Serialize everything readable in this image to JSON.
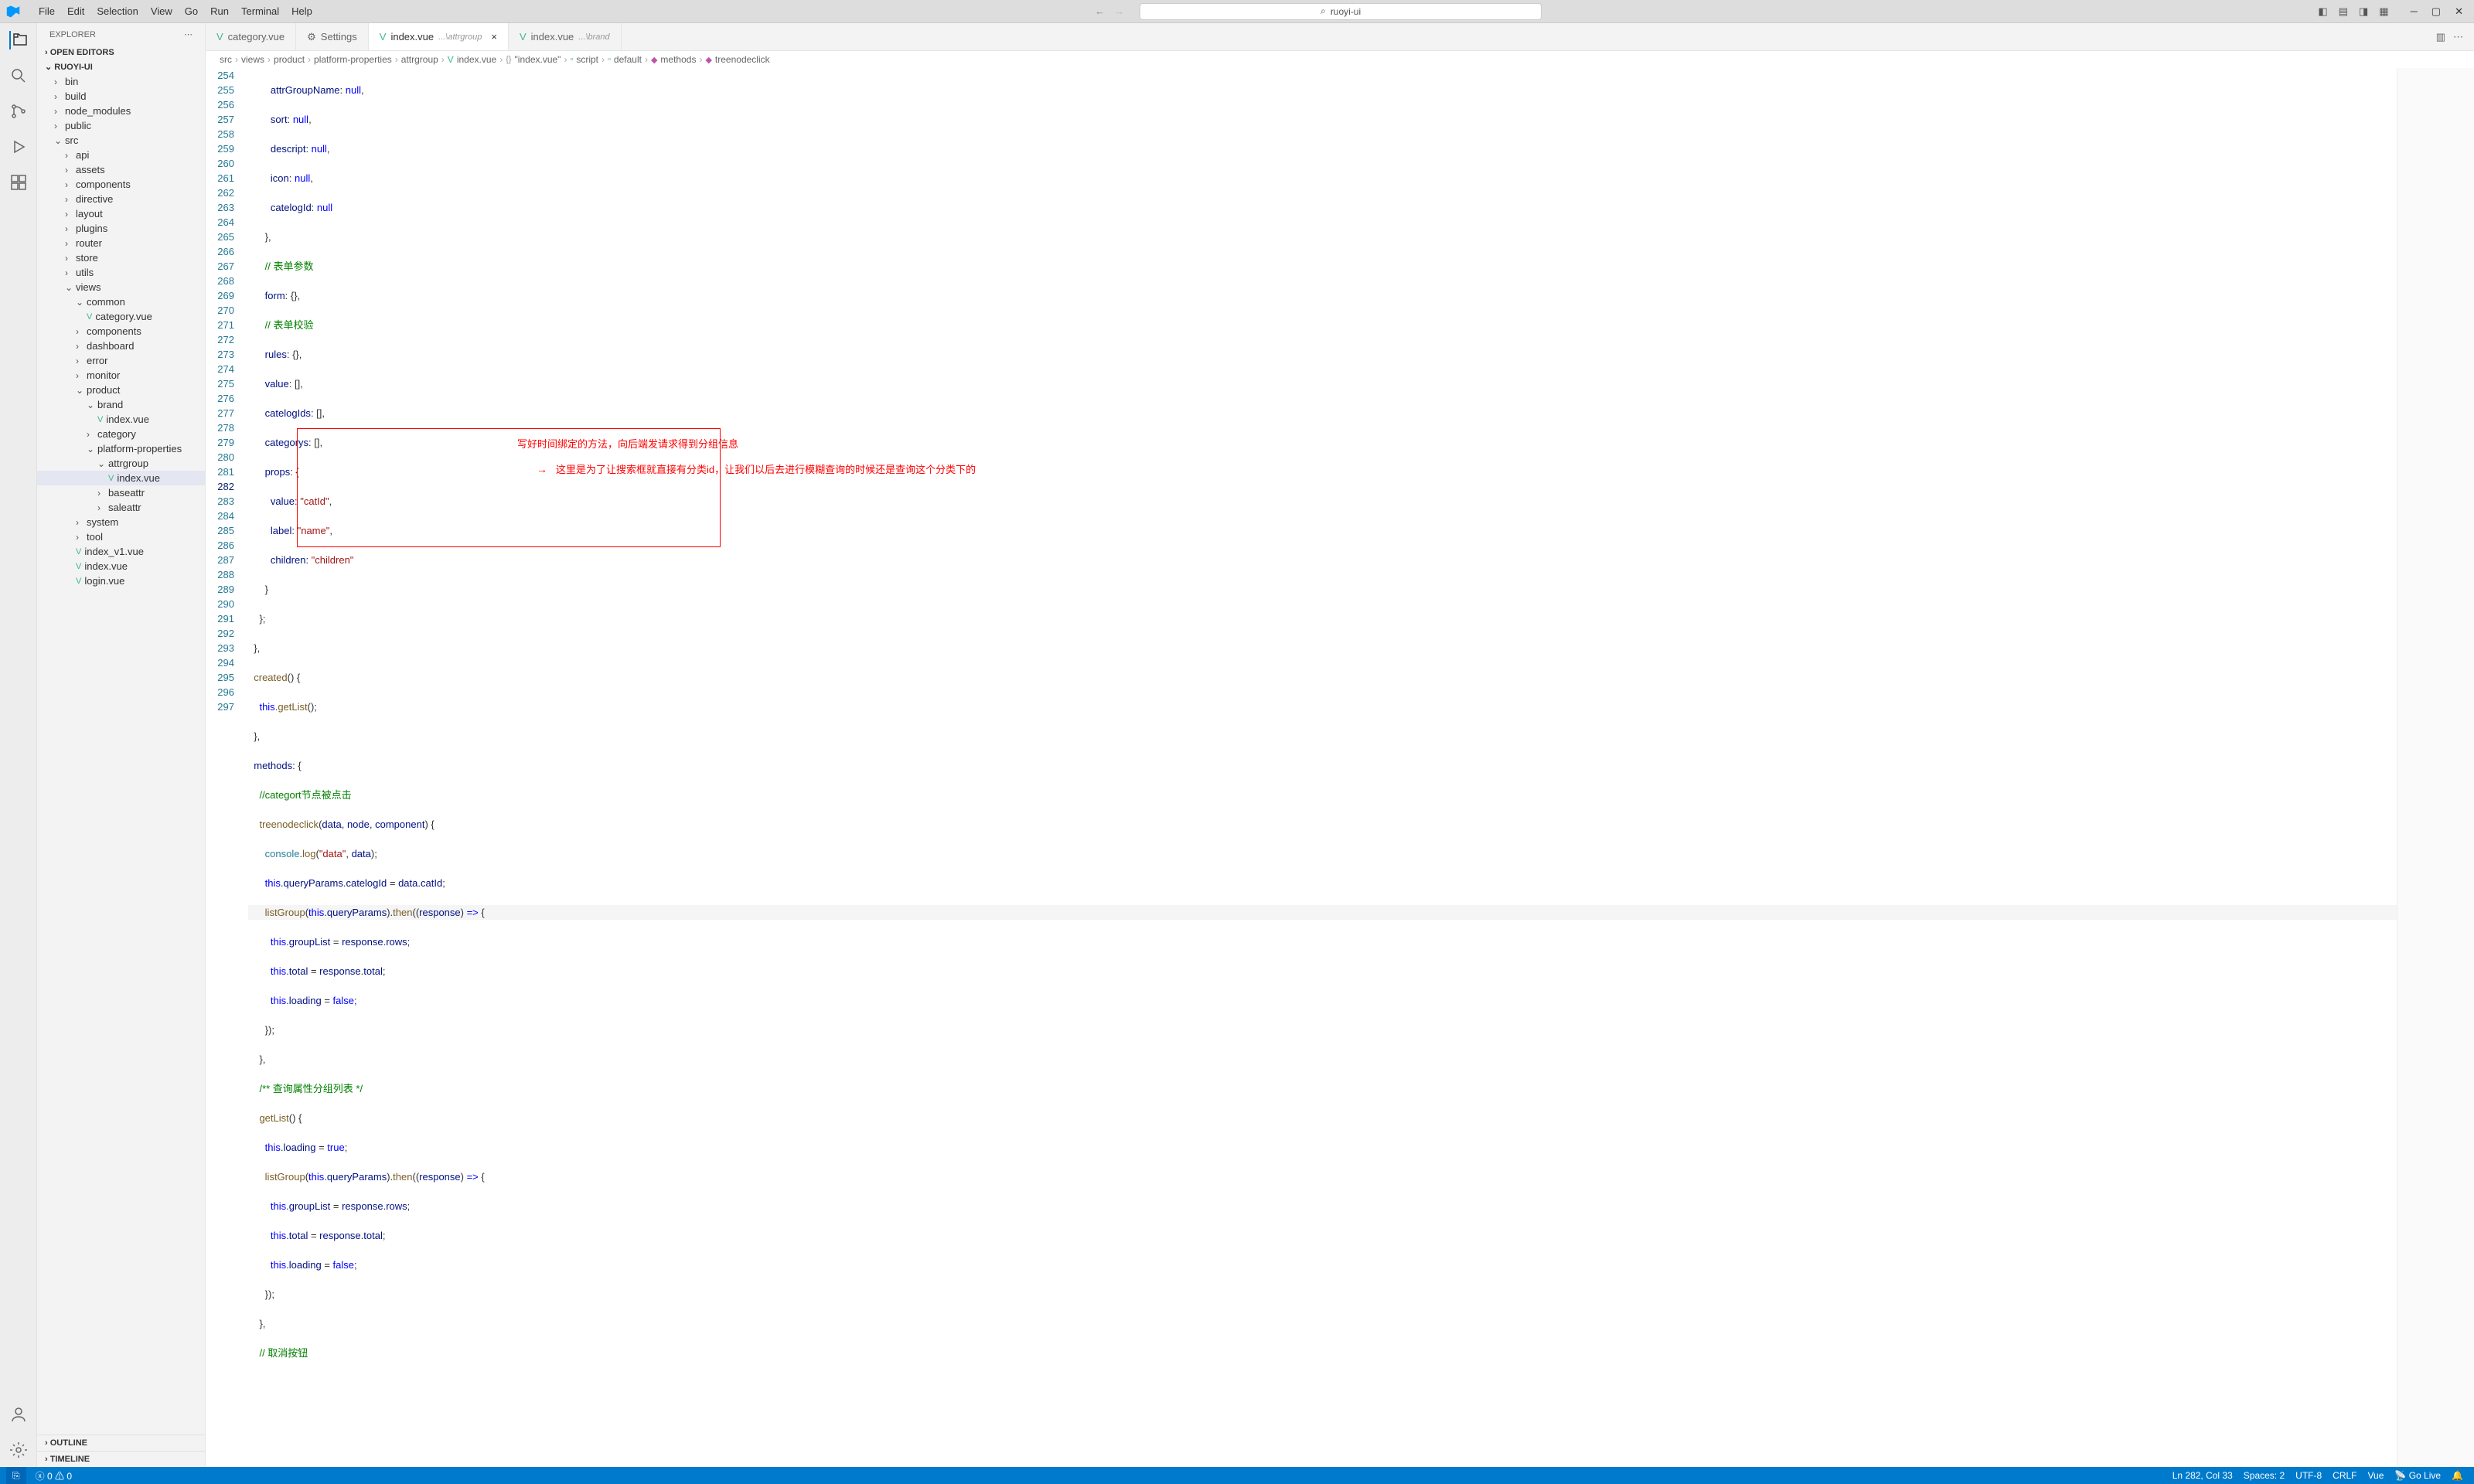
{
  "app": {
    "search_text": "ruoyi-ui"
  },
  "menu": {
    "file": "File",
    "edit": "Edit",
    "selection": "Selection",
    "view": "View",
    "go": "Go",
    "run": "Run",
    "terminal": "Terminal",
    "help": "Help"
  },
  "sidebar": {
    "title": "EXPLORER",
    "section_open": "OPEN EDITORS",
    "project": "RUOYI-UI",
    "outline": "OUTLINE",
    "timeline": "TIMELINE",
    "items": {
      "bin": "bin",
      "build": "build",
      "node_modules": "node_modules",
      "public": "public",
      "src": "src",
      "api": "api",
      "assets": "assets",
      "components": "components",
      "directive": "directive",
      "layout": "layout",
      "plugins": "plugins",
      "router": "router",
      "store": "store",
      "utils": "utils",
      "views": "views",
      "common": "common",
      "category_vue": "category.vue",
      "components2": "components",
      "dashboard": "dashboard",
      "error": "error",
      "monitor": "monitor",
      "product": "product",
      "brand": "brand",
      "index_vue": "index.vue",
      "category": "category",
      "platform_properties": "platform-properties",
      "attrgroup": "attrgroup",
      "index_vue2": "index.vue",
      "baseattr": "baseattr",
      "saleattr": "saleattr",
      "system": "system",
      "tool": "tool",
      "index_v1": "index_v1.vue",
      "index_vue3": "index.vue",
      "login_vue": "login.vue"
    }
  },
  "tabs": {
    "t1": {
      "label": "category.vue"
    },
    "t2": {
      "label": "Settings"
    },
    "t3": {
      "label": "index.vue",
      "desc": "...\\attrgroup"
    },
    "t4": {
      "label": "index.vue",
      "desc": "...\\brand"
    }
  },
  "breadcrumb": {
    "b1": "src",
    "b2": "views",
    "b3": "product",
    "b4": "platform-properties",
    "b5": "attrgroup",
    "b6": "index.vue",
    "b7": "\"index.vue\"",
    "b8": "script",
    "b9": "default",
    "b10": "methods",
    "b11": "treenodeclick"
  },
  "code": {
    "lines": [
      254,
      255,
      256,
      257,
      258,
      259,
      260,
      261,
      262,
      263,
      264,
      265,
      266,
      267,
      268,
      269,
      270,
      271,
      272,
      273,
      274,
      275,
      276,
      277,
      278,
      279,
      280,
      281,
      282,
      283,
      284,
      285,
      286,
      287,
      288,
      289,
      290,
      291,
      292,
      293,
      294,
      295,
      296,
      297
    ],
    "current_line": 282
  },
  "annotations": {
    "note1": "写好时间绑定的方法，向后端发请求得到分组信息",
    "note2": "这里是为了让搜索框就直接有分类id，让我们以后去进行模糊查询的时候还是查询这个分类下的"
  },
  "statusbar": {
    "errors": "0",
    "warnings": "0",
    "ln_col": "Ln 282, Col 33",
    "spaces": "Spaces: 2",
    "encoding": "UTF-8",
    "eol": "CRLF",
    "lang": "Vue",
    "golive": "Go Live"
  },
  "chart_data": null
}
